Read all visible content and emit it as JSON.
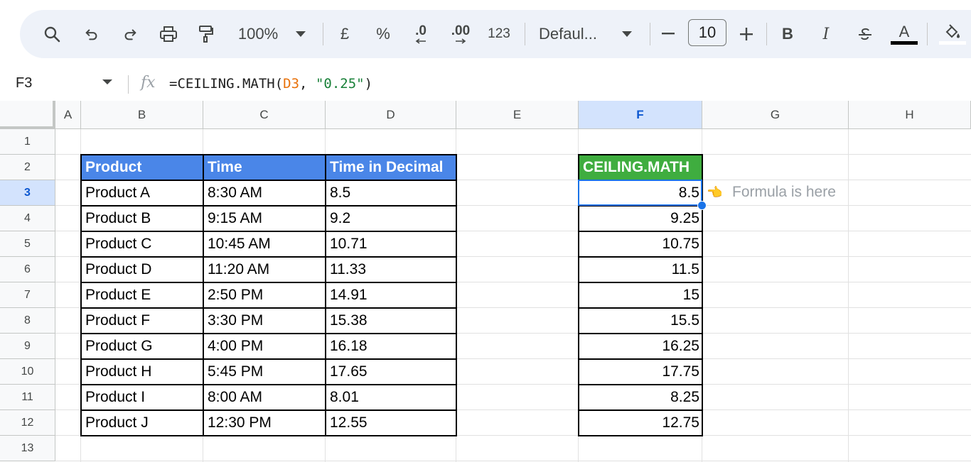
{
  "toolbar": {
    "zoom": "100%",
    "currency": "£",
    "percent": "%",
    "decrease_decimal": ".0",
    "increase_decimal": ".00",
    "number_format": "123",
    "font_family": "Defaul...",
    "font_size": "10",
    "bold": "B",
    "italic": "I",
    "text_color": "A"
  },
  "formula_bar": {
    "cell_ref": "F3",
    "fx": "fx",
    "formula_prefix": "=CEILING.MATH(",
    "formula_ref": "D3",
    "formula_sep": ", ",
    "formula_str": "\"0.25\"",
    "formula_suffix": ")"
  },
  "columns": [
    "A",
    "B",
    "C",
    "D",
    "E",
    "F",
    "G",
    "H"
  ],
  "rows": [
    "1",
    "2",
    "3",
    "4",
    "5",
    "6",
    "7",
    "8",
    "9",
    "10",
    "11",
    "12",
    "13"
  ],
  "table": {
    "headers": [
      "Product",
      "Time",
      "Time in Decimal"
    ],
    "rows": [
      [
        "Product A",
        "8:30 AM",
        "8.5"
      ],
      [
        "Product B",
        "9:15 AM",
        "9.2"
      ],
      [
        "Product C",
        "10:45 AM",
        "10.71"
      ],
      [
        "Product D",
        "11:20 AM",
        "11.33"
      ],
      [
        "Product E",
        "2:50 PM",
        "14.91"
      ],
      [
        "Product F",
        "3:30 PM",
        "15.38"
      ],
      [
        "Product G",
        "4:00 PM",
        "16.18"
      ],
      [
        "Product H",
        "5:45 PM",
        "17.65"
      ],
      [
        "Product I",
        "8:00 AM",
        "8.01"
      ],
      [
        "Product J",
        "12:30 PM",
        "12.55"
      ]
    ]
  },
  "result": {
    "header": "CEILING.MATH",
    "values": [
      "8.5",
      "9.25",
      "10.75",
      "11.5",
      "15",
      "15.5",
      "16.25",
      "17.75",
      "8.25",
      "12.75"
    ]
  },
  "annotation": {
    "hand": "👈",
    "text": "Formula is here"
  },
  "colors": {
    "header_blue": "#4a86e8",
    "header_green": "#3fad3f",
    "selection": "#1a73e8",
    "toolbar_bg": "#eef2f9"
  }
}
